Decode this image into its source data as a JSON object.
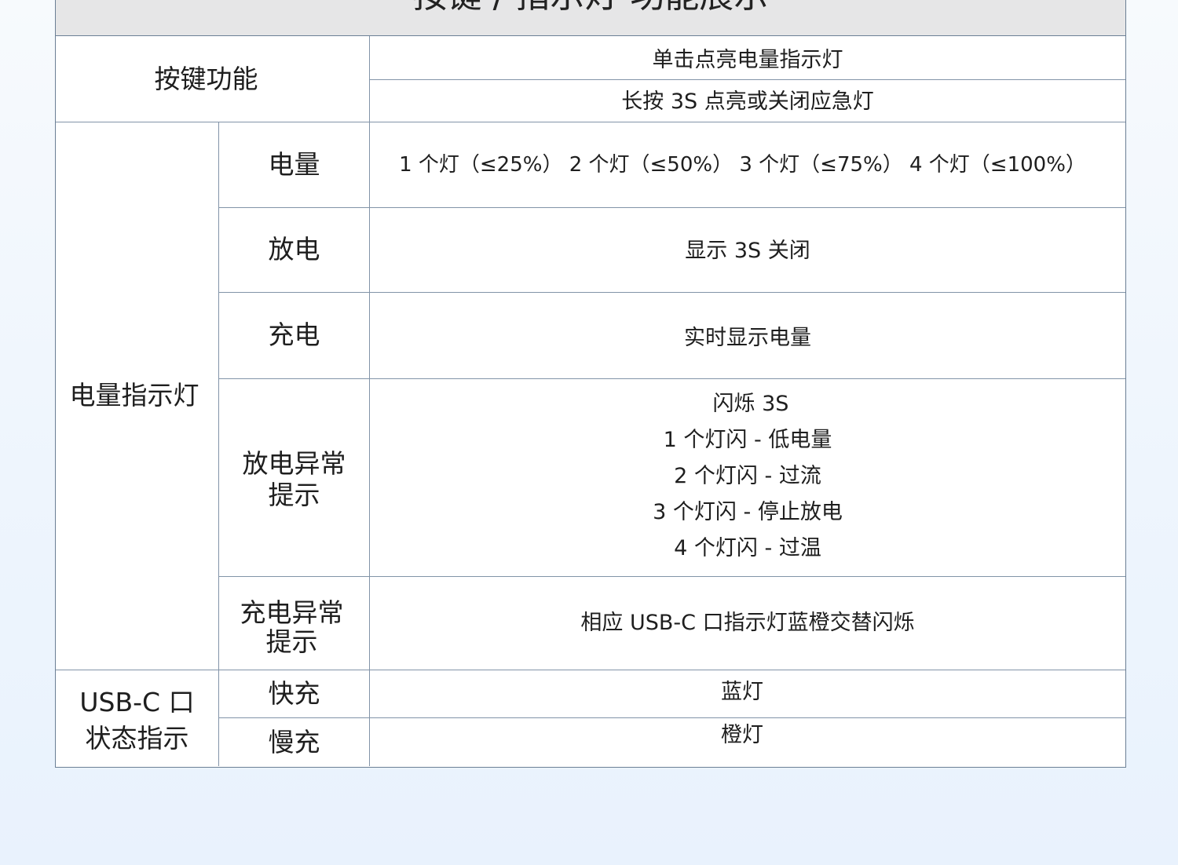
{
  "table": {
    "title": "按键 / 指示灯 功能展示",
    "button": {
      "label": "按键功能",
      "functions": [
        "单击点亮电量指示灯",
        "长按 3S 点亮或关闭应急灯"
      ]
    },
    "indicator": {
      "label": "电量指示灯",
      "rows": [
        {
          "name": "电量",
          "value": "1 个灯（≤25%） 2 个灯（≤50%） 3 个灯（≤75%） 4 个灯（≤100%）"
        },
        {
          "name": "放电",
          "value": "显示 3S 关闭"
        },
        {
          "name": "充电",
          "value": "实时显示电量"
        },
        {
          "name_lines": [
            "放电异常",
            "提示"
          ],
          "lines": [
            "闪烁 3S",
            "1 个灯闪 - 低电量",
            "2 个灯闪 - 过流",
            "3 个灯闪 - 停止放电",
            "4 个灯闪 - 过温"
          ]
        },
        {
          "name_lines": [
            "充电异常",
            "提示"
          ],
          "value": "相应 USB-C 口指示灯蓝橙交替闪烁"
        }
      ]
    },
    "usb": {
      "label_lines": [
        "USB-C 口",
        "状态指示"
      ],
      "rows": [
        {
          "name": "快充",
          "value": "蓝灯"
        },
        {
          "name": "慢充",
          "value": "橙灯"
        }
      ]
    }
  }
}
